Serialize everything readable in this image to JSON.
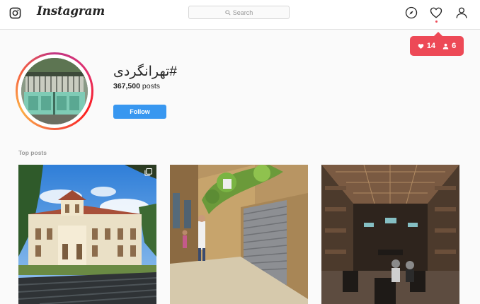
{
  "header": {
    "brand": "Instagram",
    "search_placeholder": "Search",
    "nav_icons": [
      "explore-compass-icon",
      "activity-heart-icon",
      "profile-person-icon"
    ]
  },
  "notifications": {
    "likes": "14",
    "follows": "6",
    "color": "#ed4956"
  },
  "profile": {
    "hashtag": "#تهرانگردی",
    "post_count": "367,500",
    "post_suffix": " posts",
    "follow_label": "Follow"
  },
  "section": {
    "top_posts_label": "Top posts"
  },
  "colors": {
    "accent": "#3897f0",
    "background": "#fafafa"
  }
}
